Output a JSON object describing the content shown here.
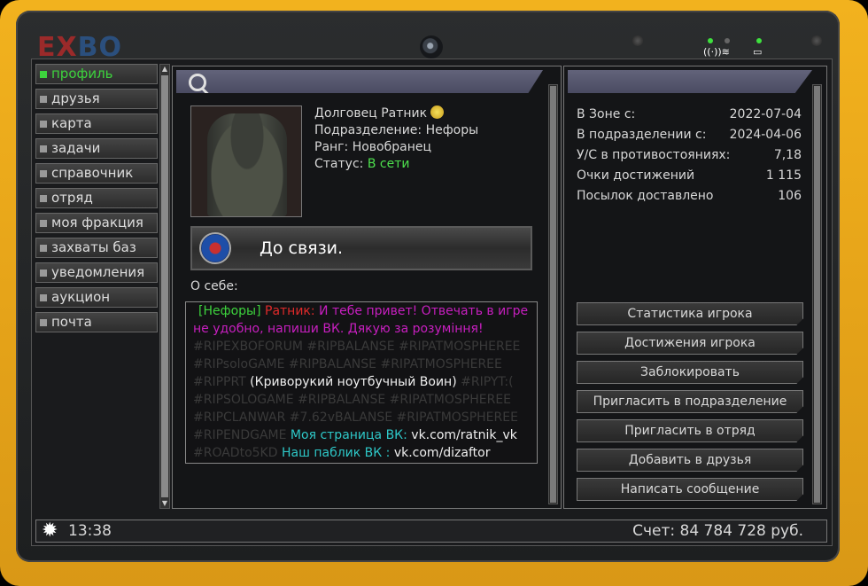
{
  "logo": {
    "ex": "EX",
    "bo": "BO"
  },
  "sidebar": {
    "items": [
      {
        "label": "профиль",
        "active": true
      },
      {
        "label": "друзья"
      },
      {
        "label": "карта"
      },
      {
        "label": "задачи"
      },
      {
        "label": "справочник"
      },
      {
        "label": "отряд"
      },
      {
        "label": "моя фракция"
      },
      {
        "label": "захваты баз"
      },
      {
        "label": "уведомления"
      },
      {
        "label": "аукцион"
      },
      {
        "label": "почта"
      }
    ]
  },
  "profile": {
    "name": "Долговец Ратник",
    "division": "Подразделение: Нефоры",
    "rank": "Ранг: Новобранец",
    "status_label": "Статус: ",
    "status_value": "В сети",
    "radio_text": "До связи.",
    "about_label": "О себе:"
  },
  "about": {
    "l1": {
      "a": "[Нефоры]",
      "b": " Ратник:",
      "c": "  И тебе привет! Отвечать в игре"
    },
    "l2": "не удобно, напиши ВК. Дякую за розуміння!",
    "l3": "#RIPEXBOFORUM #RIPBALANSE  #RIPATMOSPHEREE",
    "l4": "#RIPsoloGAME  #RIPBALANSE  #RIPATMOSPHEREE",
    "l5": {
      "a": "#RIPPRT",
      "b": "  (Криворукий ноутбучный Воин)",
      "c": " #RIPYT:("
    },
    "l6": "#RIPSOLOGAME #RIPBALANSE #RIPATMOSPHEREE",
    "l7": "#RIPCLANWAR #7.62vBALANSE #RIPATMOSPHEREE",
    "l8": {
      "a": "#RIPENDGAME",
      "b": "   Моя страница ВК:",
      "c": " vk.com/ratnik_vk"
    },
    "l9": {
      "a": "#ROADto5KD",
      "b": "      Наш паблик ВК  :",
      "c": "  vk.com/dizaftor"
    }
  },
  "stats": [
    {
      "label": "В Зоне с:",
      "value": "2022-07-04"
    },
    {
      "label": "В подразделении с:",
      "value": "2024-04-06"
    },
    {
      "label": "У/С в противостояниях:",
      "value": "7,18"
    },
    {
      "label": "Очки достижений",
      "value": "1 115"
    },
    {
      "label": "Посылок доставлено",
      "value": "106"
    }
  ],
  "buttons": [
    "Статистика игрока",
    "Достижения игрока",
    "Заблокировать",
    "Пригласить в подразделение",
    "Пригласить в отряд",
    "Добавить в друзья",
    "Написать сообщение"
  ],
  "bottom": {
    "time": "13:38",
    "account": "Счет: 84 784 728 руб."
  },
  "colors": {
    "accent_green": "#3dd23d",
    "frame": "#f2b21e",
    "panel_header": "#55566e"
  }
}
